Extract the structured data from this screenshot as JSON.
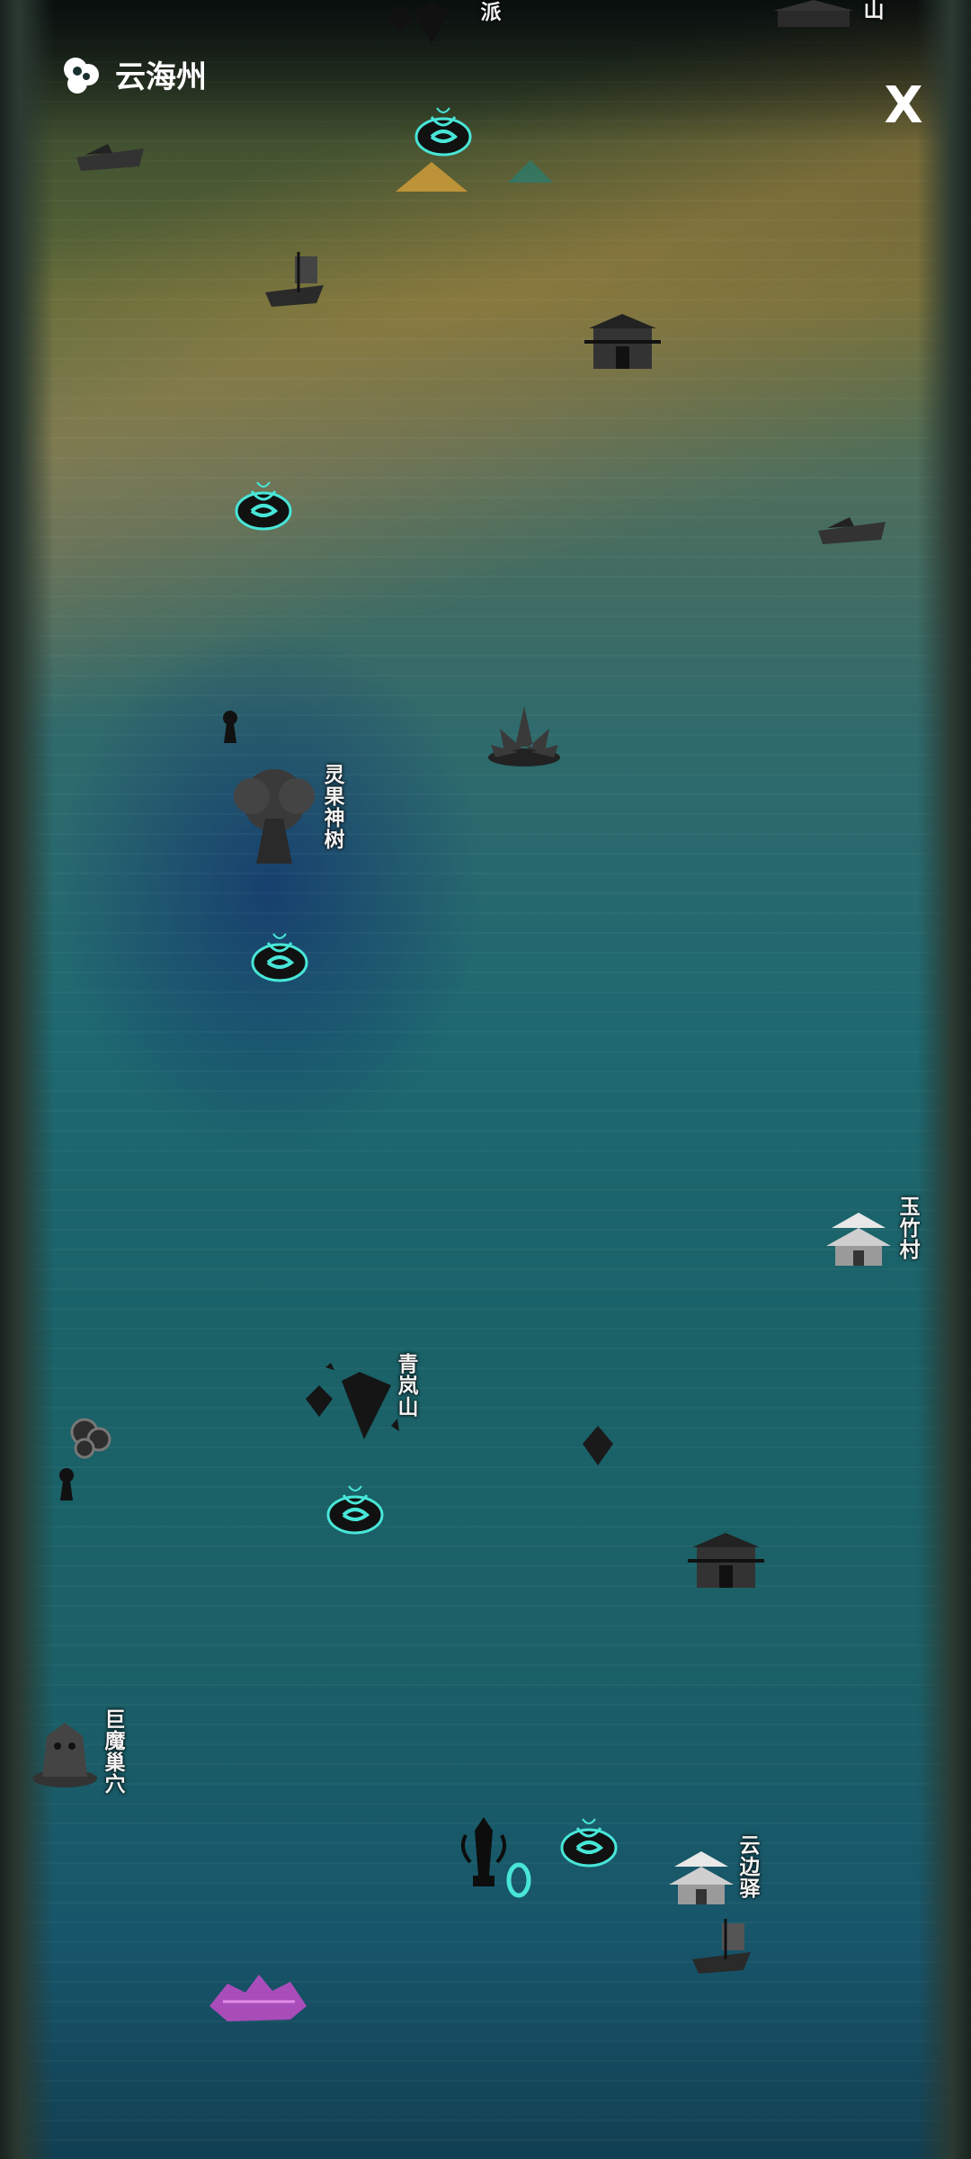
{
  "header": {
    "region_title": "云海州",
    "logo_icon": "cloud-icon",
    "close_label": "X"
  },
  "top_partial_labels": {
    "left": "派",
    "right": "山"
  },
  "locations": {
    "lingguo_tree": "灵果神树",
    "yuzhu_village": "玉竹村",
    "qinglan_mountain": "青岚山",
    "jumo_lair": "巨魔巢穴",
    "yunbian_post": "云边驿"
  },
  "colors": {
    "portal_glow": "#48e6d8",
    "sea": "#1e6870",
    "highlight": "#d6a03a",
    "demon_purple": "#c24cc8"
  }
}
